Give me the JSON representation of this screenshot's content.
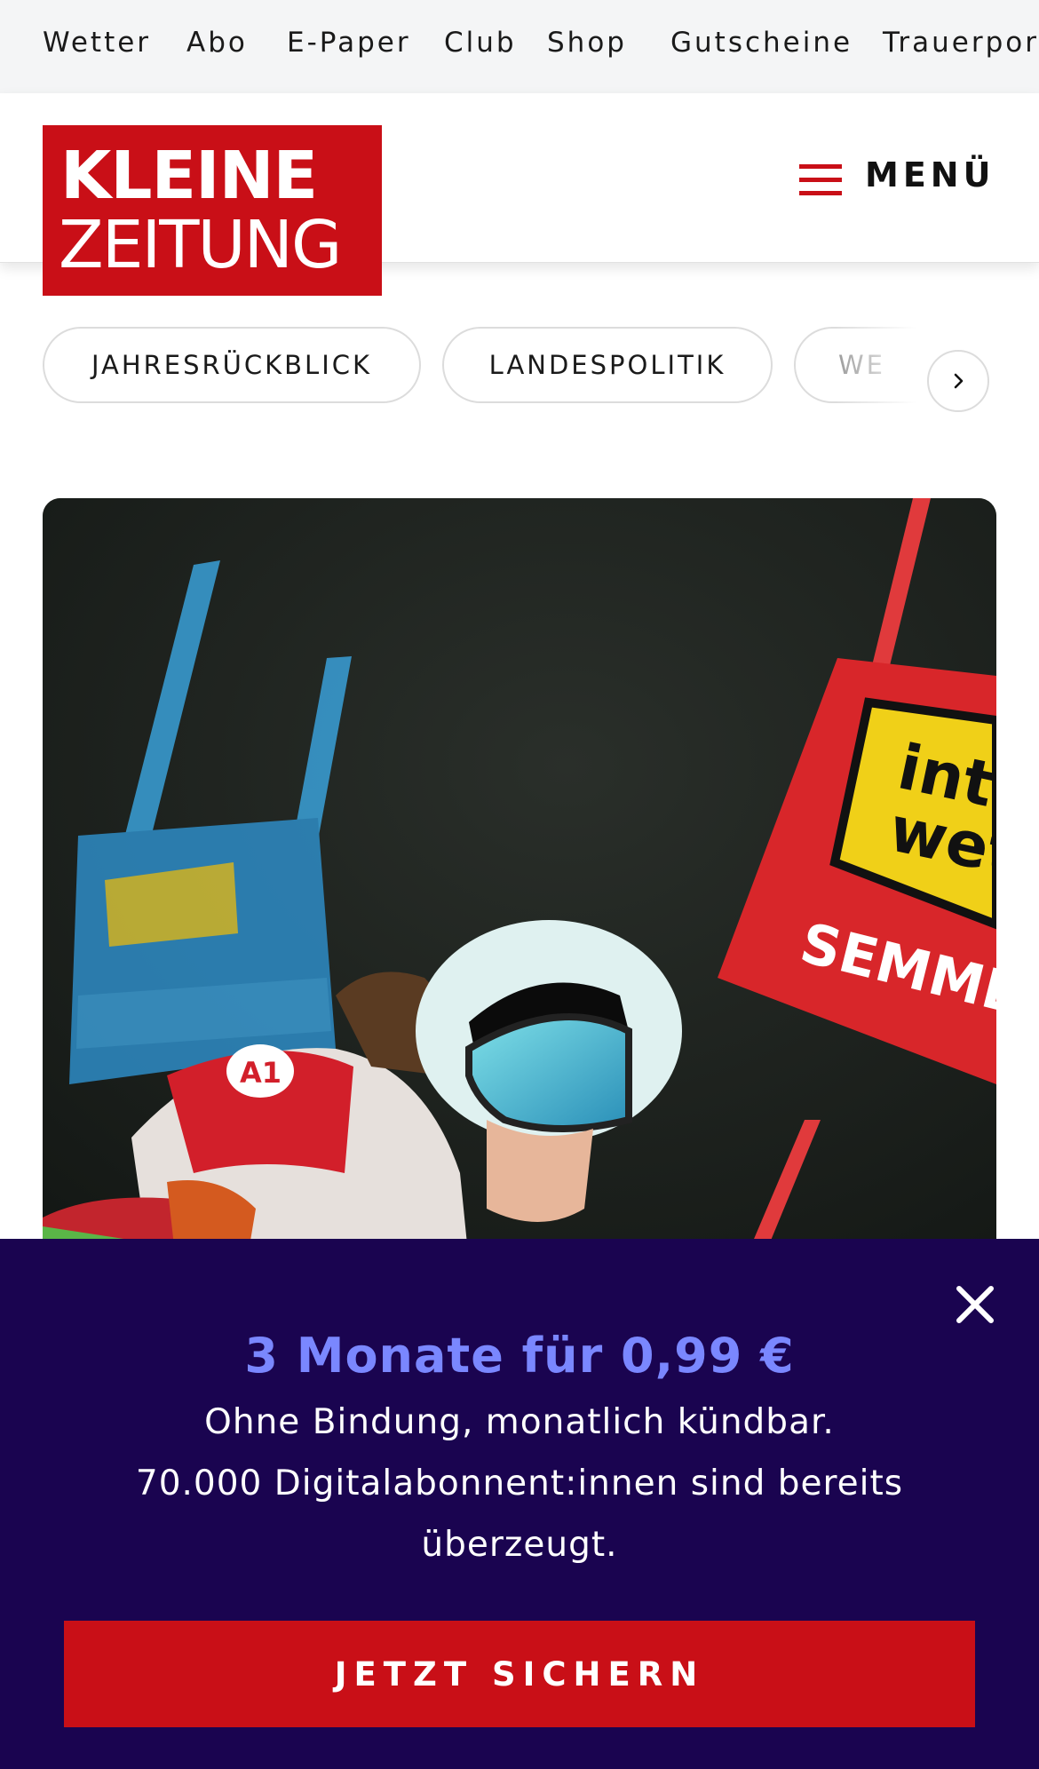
{
  "topnav": {
    "items": [
      "Wetter",
      "Abo",
      "E-Paper",
      "Club",
      "Shop",
      "Gutscheine",
      "Trauerportal"
    ]
  },
  "header": {
    "logo_line1": "KLEINE",
    "logo_line2": "ZEITUNG",
    "menu_label": "MENÜ"
  },
  "topics": {
    "chips": [
      "JAHRESRÜCKBLICK",
      "LANDESPOLITIK",
      "WE"
    ]
  },
  "promo": {
    "title": "3 Monate für 0,99 €",
    "line1": "Ohne Bindung, monatlich kündbar.",
    "line2": "70.000 Digitalabonnent:innen sind bereits überzeugt.",
    "cta": "JETZT SICHERN"
  },
  "colors": {
    "brand_red": "#c90f17",
    "overlay_bg": "#1a0450",
    "promo_accent": "#7a87ff"
  }
}
